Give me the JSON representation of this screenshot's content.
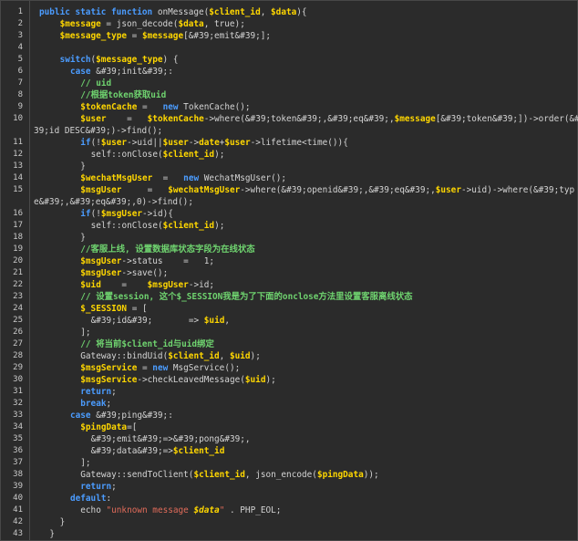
{
  "editor": {
    "language": "php",
    "colors": {
      "background": "#2b2b2b",
      "keyword": "#4b9cff",
      "keyword_alt": "#cc7832",
      "variable": "#ffd700",
      "comment": "#6fd36f",
      "string": "#e06b5a",
      "plain": "#d4d4d4"
    },
    "lines": [
      {
        "n": "1",
        "indent": 0,
        "tokens": [
          [
            "kb",
            "public static function "
          ],
          [
            "p",
            "onMessage("
          ],
          [
            "v",
            "$client_id"
          ],
          [
            "p",
            ", "
          ],
          [
            "v",
            "$data"
          ],
          [
            "p",
            "){"
          ]
        ]
      },
      {
        "n": "2",
        "indent": 4,
        "tokens": [
          [
            "v",
            "$message"
          ],
          [
            "p",
            " = json_decode("
          ],
          [
            "v",
            "$data"
          ],
          [
            "p",
            ", true);"
          ]
        ]
      },
      {
        "n": "3",
        "indent": 4,
        "tokens": [
          [
            "v",
            "$message_type"
          ],
          [
            "p",
            " = "
          ],
          [
            "v",
            "$message"
          ],
          [
            "p",
            "[&#39;emit&#39;];"
          ]
        ]
      },
      {
        "n": "4",
        "indent": 0,
        "tokens": []
      },
      {
        "n": "5",
        "indent": 4,
        "tokens": [
          [
            "kb",
            "switch"
          ],
          [
            "p",
            "("
          ],
          [
            "v",
            "$message_type"
          ],
          [
            "p",
            ") {"
          ]
        ]
      },
      {
        "n": "6",
        "indent": 6,
        "tokens": [
          [
            "kb",
            "case "
          ],
          [
            "p",
            "&#39;init&#39;:"
          ]
        ]
      },
      {
        "n": "7",
        "indent": 8,
        "tokens": [
          [
            "c",
            "// uid"
          ]
        ]
      },
      {
        "n": "8",
        "indent": 8,
        "tokens": [
          [
            "c",
            "//根据token获取uid"
          ]
        ]
      },
      {
        "n": "9",
        "indent": 8,
        "tokens": [
          [
            "v",
            "$tokenCache"
          ],
          [
            "p",
            " =   "
          ],
          [
            "kb",
            "new "
          ],
          [
            "p",
            "TokenCache();"
          ]
        ]
      },
      {
        "n": "10",
        "indent": 8,
        "tokens": [
          [
            "v",
            "$user"
          ],
          [
            "p",
            "    =   "
          ],
          [
            "v",
            "$tokenCache"
          ],
          [
            "p",
            "->where(&#39;token&#39;,&#39;eq&#39;,"
          ],
          [
            "v",
            "$message"
          ],
          [
            "p",
            "[&#39;token&#39;])->order(&#"
          ]
        ],
        "wrap": [
          [
            "p",
            "39;id DESC&#39;)->find();"
          ]
        ]
      },
      {
        "n": "11",
        "indent": 8,
        "tokens": [
          [
            "kb",
            "if"
          ],
          [
            "p",
            "(!"
          ],
          [
            "v",
            "$user"
          ],
          [
            "p",
            "->uid||"
          ],
          [
            "v",
            "$user"
          ],
          [
            "p",
            "->"
          ],
          [
            "v",
            "date"
          ],
          [
            "p",
            "+"
          ],
          [
            "v",
            "$user"
          ],
          [
            "p",
            "->lifetime<time()){"
          ]
        ]
      },
      {
        "n": "12",
        "indent": 10,
        "tokens": [
          [
            "p",
            "self::onClose("
          ],
          [
            "v",
            "$client_id"
          ],
          [
            "p",
            ");"
          ]
        ]
      },
      {
        "n": "13",
        "indent": 8,
        "tokens": [
          [
            "p",
            "}"
          ]
        ]
      },
      {
        "n": "14",
        "indent": 8,
        "tokens": [
          [
            "v",
            "$wechatMsgUser"
          ],
          [
            "p",
            "  =   "
          ],
          [
            "kb",
            "new "
          ],
          [
            "p",
            "WechatMsgUser();"
          ]
        ]
      },
      {
        "n": "15",
        "indent": 8,
        "tokens": [
          [
            "v",
            "$msgUser"
          ],
          [
            "p",
            "     =   "
          ],
          [
            "v",
            "$wechatMsgUser"
          ],
          [
            "p",
            "->where(&#39;openid&#39;,&#39;eq&#39;,"
          ],
          [
            "v",
            "$user"
          ],
          [
            "p",
            "->uid)->where(&#39;typ"
          ]
        ],
        "wrap": [
          [
            "p",
            "e&#39;,&#39;eq&#39;,0)->find();"
          ]
        ]
      },
      {
        "n": "16",
        "indent": 8,
        "tokens": [
          [
            "kb",
            "if"
          ],
          [
            "p",
            "(!"
          ],
          [
            "v",
            "$msgUser"
          ],
          [
            "p",
            "->id){"
          ]
        ]
      },
      {
        "n": "17",
        "indent": 10,
        "tokens": [
          [
            "p",
            "self::onClose("
          ],
          [
            "v",
            "$client_id"
          ],
          [
            "p",
            ");"
          ]
        ]
      },
      {
        "n": "18",
        "indent": 8,
        "tokens": [
          [
            "p",
            "}"
          ]
        ]
      },
      {
        "n": "19",
        "indent": 8,
        "tokens": [
          [
            "c",
            "//客服上线, 设置数据库状态字段为在线状态"
          ]
        ]
      },
      {
        "n": "20",
        "indent": 8,
        "tokens": [
          [
            "v",
            "$msgUser"
          ],
          [
            "p",
            "->status    =   1;"
          ]
        ]
      },
      {
        "n": "21",
        "indent": 8,
        "tokens": [
          [
            "v",
            "$msgUser"
          ],
          [
            "p",
            "->save();"
          ]
        ]
      },
      {
        "n": "22",
        "indent": 8,
        "tokens": [
          [
            "v",
            "$uid"
          ],
          [
            "p",
            "    =    "
          ],
          [
            "v",
            "$msgUser"
          ],
          [
            "p",
            "->id;"
          ]
        ]
      },
      {
        "n": "23",
        "indent": 8,
        "tokens": [
          [
            "c",
            "// 设置session, 这个$_SESSION我是为了下面的onclose方法里设置客服离线状态"
          ]
        ]
      },
      {
        "n": "24",
        "indent": 8,
        "tokens": [
          [
            "v",
            "$_SESSION"
          ],
          [
            "p",
            " = ["
          ]
        ]
      },
      {
        "n": "25",
        "indent": 10,
        "tokens": [
          [
            "p",
            "&#39;id&#39;       => "
          ],
          [
            "v",
            "$uid"
          ],
          [
            "p",
            ","
          ]
        ]
      },
      {
        "n": "26",
        "indent": 8,
        "tokens": [
          [
            "p",
            "];"
          ]
        ]
      },
      {
        "n": "27",
        "indent": 8,
        "tokens": [
          [
            "c",
            "// 将当前$client_id与uid绑定"
          ]
        ]
      },
      {
        "n": "28",
        "indent": 8,
        "tokens": [
          [
            "p",
            "Gateway::bindUid("
          ],
          [
            "v",
            "$client_id"
          ],
          [
            "p",
            ", "
          ],
          [
            "v",
            "$uid"
          ],
          [
            "p",
            ");"
          ]
        ]
      },
      {
        "n": "29",
        "indent": 8,
        "tokens": [
          [
            "v",
            "$msgService"
          ],
          [
            "p",
            " = "
          ],
          [
            "kb",
            "new "
          ],
          [
            "p",
            "MsgService();"
          ]
        ]
      },
      {
        "n": "30",
        "indent": 8,
        "tokens": [
          [
            "v",
            "$msgService"
          ],
          [
            "p",
            "->checkLeavedMessage("
          ],
          [
            "v",
            "$uid"
          ],
          [
            "p",
            ");"
          ]
        ]
      },
      {
        "n": "31",
        "indent": 8,
        "tokens": [
          [
            "kb",
            "return"
          ],
          [
            "p",
            ";"
          ]
        ]
      },
      {
        "n": "32",
        "indent": 8,
        "tokens": [
          [
            "kb",
            "break"
          ],
          [
            "p",
            ";"
          ]
        ]
      },
      {
        "n": "33",
        "indent": 6,
        "tokens": [
          [
            "kb",
            "case "
          ],
          [
            "p",
            "&#39;ping&#39;:"
          ]
        ]
      },
      {
        "n": "34",
        "indent": 8,
        "tokens": [
          [
            "v",
            "$pingData"
          ],
          [
            "p",
            "=["
          ]
        ]
      },
      {
        "n": "35",
        "indent": 10,
        "tokens": [
          [
            "p",
            "&#39;emit&#39;=>&#39;pong&#39;,"
          ]
        ]
      },
      {
        "n": "36",
        "indent": 10,
        "tokens": [
          [
            "p",
            "&#39;data&#39;=>"
          ],
          [
            "v",
            "$client_id"
          ]
        ]
      },
      {
        "n": "37",
        "indent": 8,
        "tokens": [
          [
            "p",
            "];"
          ]
        ]
      },
      {
        "n": "38",
        "indent": 8,
        "tokens": [
          [
            "p",
            "Gateway::sendToClient("
          ],
          [
            "v",
            "$client_id"
          ],
          [
            "p",
            ", json_encode("
          ],
          [
            "v",
            "$pingData"
          ],
          [
            "p",
            "));"
          ]
        ]
      },
      {
        "n": "39",
        "indent": 8,
        "tokens": [
          [
            "kb",
            "return"
          ],
          [
            "p",
            ";"
          ]
        ]
      },
      {
        "n": "40",
        "indent": 6,
        "tokens": [
          [
            "kb",
            "default"
          ],
          [
            "p",
            ":"
          ]
        ]
      },
      {
        "n": "41",
        "indent": 8,
        "tokens": [
          [
            "p",
            "echo "
          ],
          [
            "s",
            "\"unknown message "
          ],
          [
            "i",
            "$data"
          ],
          [
            "s",
            "\""
          ],
          [
            "p",
            " . PHP_EOL;"
          ]
        ]
      },
      {
        "n": "42",
        "indent": 4,
        "tokens": [
          [
            "p",
            "}"
          ]
        ]
      },
      {
        "n": "43",
        "indent": 2,
        "tokens": [
          [
            "p",
            "}"
          ]
        ]
      }
    ]
  }
}
